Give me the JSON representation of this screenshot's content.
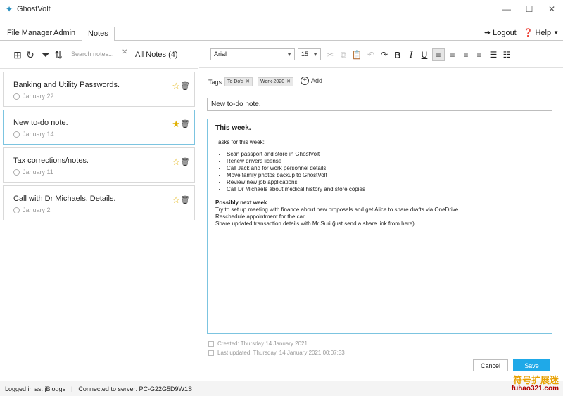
{
  "app": {
    "title": "GhostVolt",
    "window_controls": [
      "minimize-icon",
      "maximize-icon",
      "close-icon"
    ]
  },
  "menu": {
    "tabs": [
      {
        "label": "File Manager"
      },
      {
        "label": "Admin"
      },
      {
        "label": "Notes"
      }
    ],
    "active_tab": "Notes",
    "logout": "Logout",
    "help": "Help"
  },
  "notes_list": {
    "search_placeholder": "Search notes...",
    "count_label": "All Notes (4)",
    "items": [
      {
        "title": "Banking and Utility Passwords.",
        "date": "January 22",
        "starred": false
      },
      {
        "title": "New to-do note.",
        "date": "January 14",
        "starred": true
      },
      {
        "title": "Tax corrections/notes.",
        "date": "January 11",
        "starred": false
      },
      {
        "title": "Call with Dr Michaels. Details.",
        "date": "January 2",
        "starred": false
      }
    ]
  },
  "editor": {
    "font": "Arial",
    "size": "15",
    "tags_label": "Tags:",
    "tags": [
      "To Do's",
      "Work-2020"
    ],
    "add_tag": "Add",
    "note_title": "New to-do note.",
    "content": {
      "heading": "This week.",
      "intro": "Tasks for this week:",
      "bullets": [
        "Scan passport and store in GhostVolt",
        "Renew drivers license",
        "Call Jack and for work personnel details",
        "Move family photos backup to GhostVolt",
        "Review new job applications",
        "Call Dr Michaels about medical history and store copies"
      ],
      "sub_heading": "Possibly next week",
      "lines": [
        "Try to set up meeting with finance about new proposals and get Alice to share drafts via OneDrive.",
        "Reschedule appointment for the car.",
        "Share updated transaction details with Mr Suri (just send a share link from here)."
      ]
    },
    "created": "Created: Thursday 14 January 2021",
    "updated": "Last updated: Thursday, 14 January 2021 00:07:33",
    "cancel": "Cancel",
    "save": "Save"
  },
  "status": {
    "logged_in": "Logged in as: jBloggs",
    "separator": "|",
    "server": "Connected to server: PC-G22G5D9W1S"
  },
  "watermark": {
    "cn": "符号扩展迷",
    "en": "fuhao321.com"
  },
  "colors": {
    "accent": "#1fa9e8",
    "selected_border": "#7cc4e0",
    "star": "#e0b000"
  }
}
